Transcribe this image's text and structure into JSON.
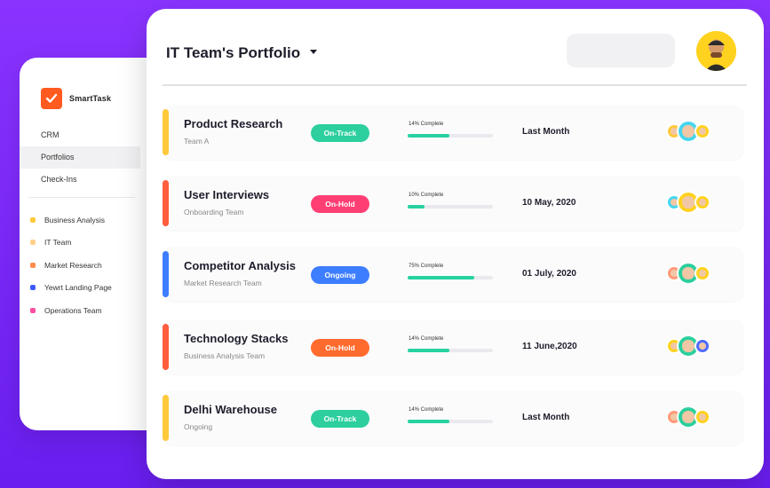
{
  "app": {
    "brand": "SmartTask"
  },
  "sidebar": {
    "nav": [
      {
        "label": "CRM",
        "active": false
      },
      {
        "label": "Portfolios",
        "active": true
      },
      {
        "label": "Check-Ins",
        "active": false
      }
    ],
    "teams": [
      {
        "label": "Business Analysis",
        "color": "#ffc93c"
      },
      {
        "label": "IT Team",
        "color": "#ffd08a"
      },
      {
        "label": "Market Research",
        "color": "#ff8b4d"
      },
      {
        "label": "Yewrt Landing Page",
        "color": "#3d5afe"
      },
      {
        "label": "Operations Team",
        "color": "#ff4fa3"
      }
    ]
  },
  "header": {
    "title": "IT Team's Portfolio"
  },
  "projects": [
    {
      "title": "Product Research",
      "team": "Team A",
      "status": "On-Track",
      "status_color": "#2ccf9d",
      "accent": "#ffc93c",
      "progress_label": "14% Complete",
      "progress": 0.49,
      "date": "Last Month",
      "avatars": [
        {
          "bg": "#ffc93c"
        },
        {
          "bg": "#46d6f0",
          "big": true
        },
        {
          "bg": "#ffd21f"
        }
      ]
    },
    {
      "title": "User Interviews",
      "team": "Onboarding Team",
      "status": "On-Hold",
      "status_color": "#ff3f74",
      "accent": "#ff5d3d",
      "progress_label": "10% Complete",
      "progress": 0.2,
      "date": "10 May, 2020",
      "avatars": [
        {
          "bg": "#46d6f0"
        },
        {
          "bg": "#ffd21f",
          "big": true
        },
        {
          "bg": "#ffd21f"
        }
      ]
    },
    {
      "title": "Competitor Analysis",
      "team": "Market Research Team",
      "status": "Ongoing",
      "status_color": "#3d7dff",
      "accent": "#3d7dff",
      "progress_label": "75% Complete",
      "progress": 0.78,
      "date": "01 July, 2020",
      "avatars": [
        {
          "bg": "#ff9a7a"
        },
        {
          "bg": "#2ccf9d",
          "big": true
        },
        {
          "bg": "#ffd21f"
        }
      ]
    },
    {
      "title": "Technology Stacks",
      "team": "Business Analysis Team",
      "status": "On-Hold",
      "status_color": "#ff6b2d",
      "accent": "#ff5d3d",
      "progress_label": "14% Complete",
      "progress": 0.49,
      "date": "11 June,2020",
      "avatars": [
        {
          "bg": "#ffd21f"
        },
        {
          "bg": "#2ccf9d",
          "big": true
        },
        {
          "bg": "#4f6bff"
        }
      ]
    },
    {
      "title": "Delhi Warehouse",
      "team": "Ongoing",
      "status": "On-Track",
      "status_color": "#2ccf9d",
      "accent": "#ffc93c",
      "progress_label": "14% Complete",
      "progress": 0.49,
      "date": "Last Month",
      "avatars": [
        {
          "bg": "#ff9a7a"
        },
        {
          "bg": "#2ccf9d",
          "big": true
        },
        {
          "bg": "#ffd21f"
        }
      ]
    }
  ]
}
